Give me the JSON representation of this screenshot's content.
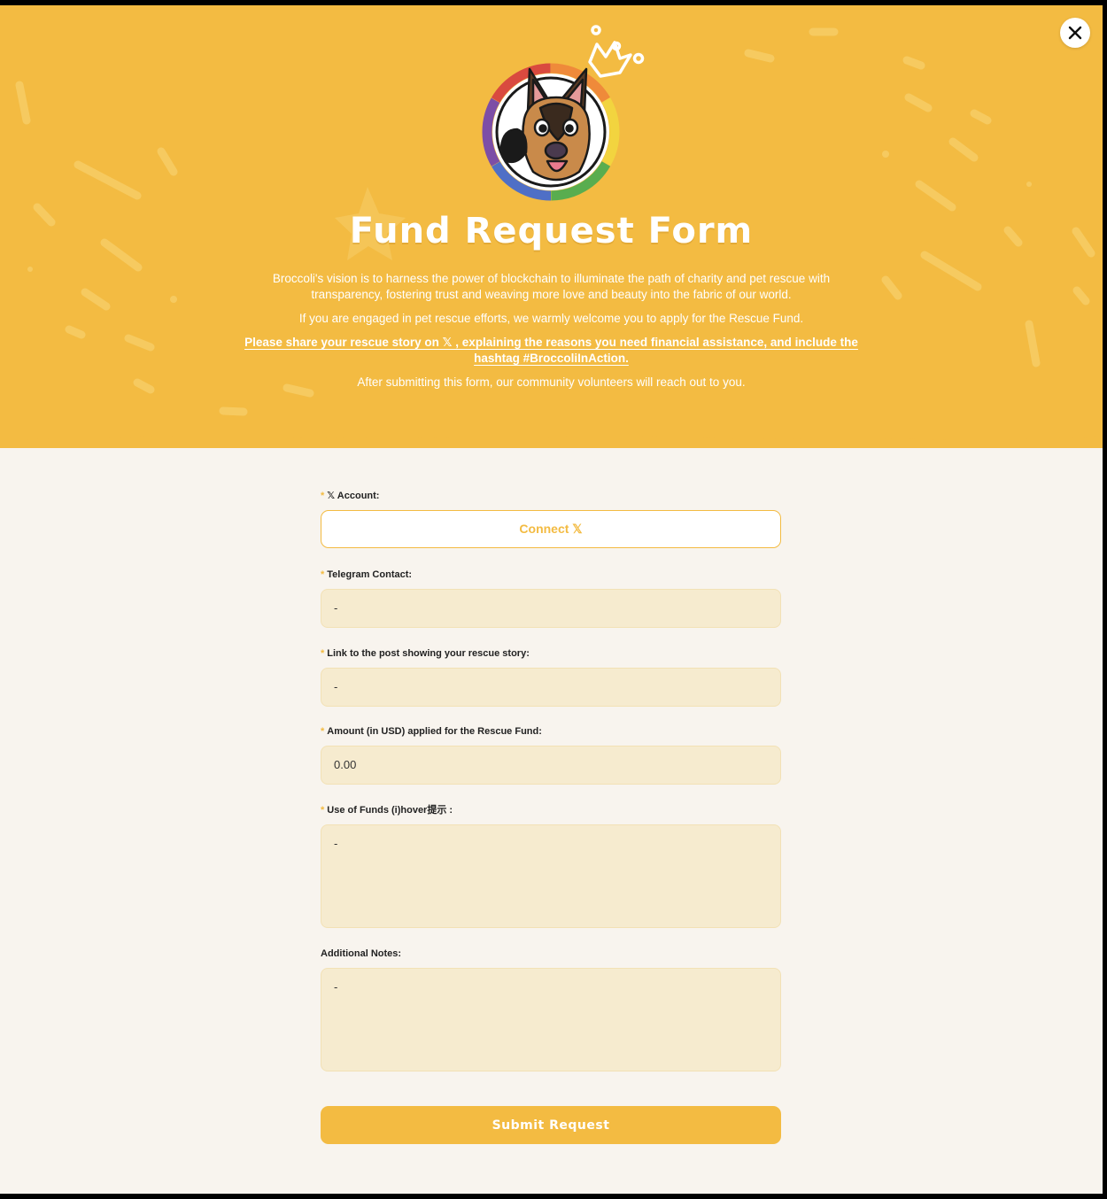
{
  "colors": {
    "accent": "#f3bb42",
    "page_background": "#f8f4ee",
    "field_background": "#f6ebcf",
    "text_dark": "#222222"
  },
  "header": {
    "close_icon": "close-icon",
    "title": "Fund Request Form",
    "intro_paragraph_1": "Broccoli's vision is to harness the power of blockchain to illuminate the path of charity and pet rescue with transparency, fostering trust and weaving more love and beauty into the fabric of our world.",
    "intro_paragraph_2": "If you are engaged in pet rescue efforts, we warmly welcome you to apply for the Rescue Fund.",
    "share_link": "Please share your rescue story on 𝕏 , explaining the reasons you need financial assistance, and include the hashtag #BroccoliInAction.",
    "intro_paragraph_4": "After submitting this form, our community volunteers will reach out to you."
  },
  "form": {
    "required_mark": "*",
    "x_account": {
      "label": "𝕏 Account:",
      "button": "Connect 𝕏"
    },
    "telegram": {
      "label": "Telegram Contact:",
      "value": "-"
    },
    "post_link": {
      "label": "Link to the post showing your rescue story:",
      "value": "-"
    },
    "amount": {
      "label": "Amount (in USD) applied for the Rescue Fund:",
      "value": "0.00"
    },
    "use_of_funds": {
      "label": "Use of Funds (i)hover提示 :",
      "value": "-"
    },
    "notes": {
      "label": "Additional Notes:",
      "value": "-"
    },
    "submit": "Submit Request"
  }
}
